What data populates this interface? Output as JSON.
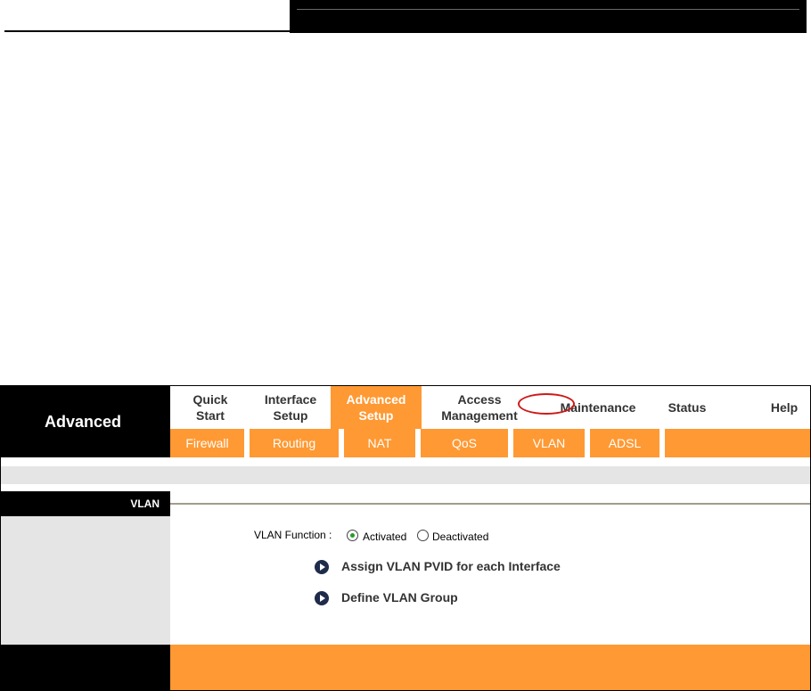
{
  "brand": "Advanced",
  "top_tabs": [
    {
      "label_line1": "Quick",
      "label_line2": "Start"
    },
    {
      "label_line1": "Interface",
      "label_line2": "Setup"
    },
    {
      "label_line1": "Advanced",
      "label_line2": "Setup",
      "active": true
    },
    {
      "label_line1": "Access",
      "label_line2": "Management"
    },
    {
      "label_line1": "Maintenance",
      "label_line2": ""
    },
    {
      "label_line1": "Status",
      "label_line2": ""
    },
    {
      "label_line1": "Help",
      "label_line2": ""
    }
  ],
  "sub_tabs": [
    "Firewall",
    "Routing",
    "NAT",
    "QoS",
    "VLAN",
    "ADSL"
  ],
  "section": {
    "title": "VLAN"
  },
  "vlan_function": {
    "label": "VLAN Function :",
    "options": [
      "Activated",
      "Deactivated"
    ],
    "selected": "Activated"
  },
  "links": [
    "Assign VLAN PVID for each Interface",
    "Define VLAN Group"
  ],
  "colors": {
    "accent": "#ff9933",
    "black": "#000000",
    "panel_grey": "#e5e5e5",
    "highlight_ring": "#cc1a1a"
  }
}
